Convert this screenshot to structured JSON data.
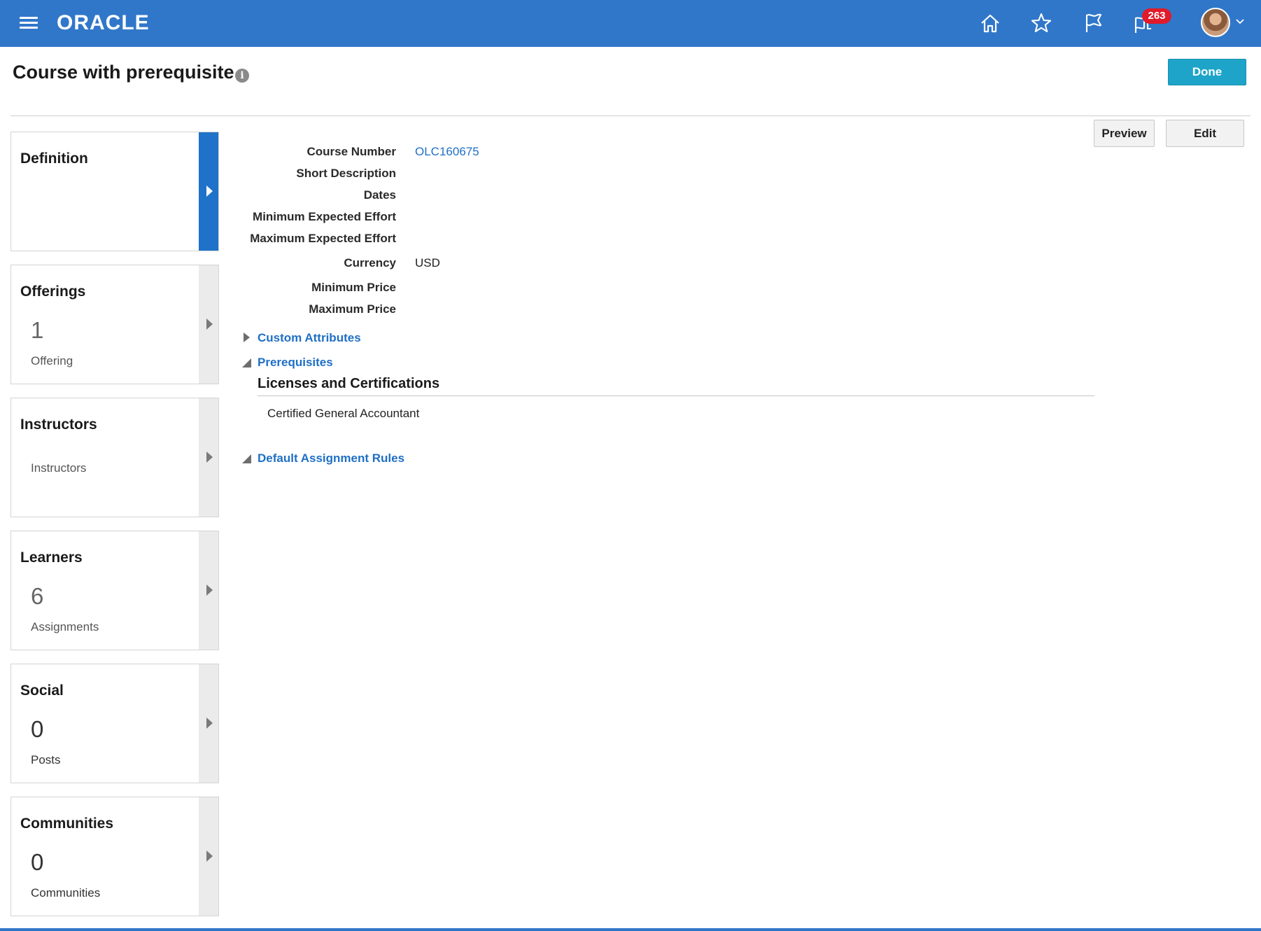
{
  "app": {
    "brand": "ORACLE",
    "notifications_count": "263",
    "colors": {
      "topbar": "#3077c9",
      "accent": "#1ea4c8",
      "link": "#1f6fc5",
      "badge": "#e01b2a",
      "active_tab": "#1e72c9"
    },
    "nav_icons": [
      "menu-icon",
      "home-icon",
      "favorites-star-icon",
      "flag-icon",
      "notifications-icon"
    ]
  },
  "page": {
    "title": "Course with prerequisite",
    "done_label": "Done"
  },
  "actions": {
    "preview_label": "Preview",
    "edit_label": "Edit"
  },
  "sidebar": {
    "tiles": [
      {
        "title": "Definition",
        "count": "",
        "sub": "",
        "active": true
      },
      {
        "title": "Offerings",
        "count": "1",
        "sub": "Offering",
        "active": false
      },
      {
        "title": "Instructors",
        "count": "",
        "sub": "Instructors",
        "active": false
      },
      {
        "title": "Learners",
        "count": "6",
        "sub": "Assignments",
        "active": false
      },
      {
        "title": "Social",
        "count": "0",
        "sub": "Posts",
        "active": false
      },
      {
        "title": "Communities",
        "count": "0",
        "sub": "Communities",
        "active": false
      }
    ]
  },
  "definition": {
    "fields": [
      {
        "label": "Course Number",
        "value": "OLC160675"
      },
      {
        "label": "Short Description",
        "value": ""
      },
      {
        "label": "Dates",
        "value": ""
      },
      {
        "label": "Minimum Expected Effort",
        "value": ""
      },
      {
        "label": "Maximum Expected Effort",
        "value": ""
      },
      {
        "label": "Currency",
        "value": "USD"
      },
      {
        "label": "Minimum Price",
        "value": ""
      },
      {
        "label": "Maximum Price",
        "value": ""
      }
    ],
    "sections": {
      "custom_attributes": {
        "label": "Custom Attributes",
        "expanded": false
      },
      "prerequisites": {
        "label": "Prerequisites",
        "expanded": true
      },
      "default_assignment_rules": {
        "label": "Default Assignment Rules",
        "expanded": true
      }
    },
    "licenses": {
      "heading": "Licenses and Certifications",
      "items": [
        "Certified General Accountant"
      ]
    }
  }
}
